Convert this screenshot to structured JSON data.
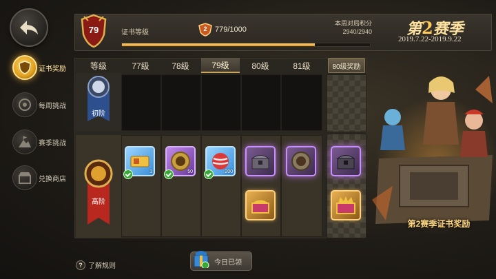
{
  "nav": {
    "back_icon": "back-arrow-icon",
    "items": [
      {
        "label": "证书奖励",
        "icon": "shield-badge-icon",
        "active": true
      },
      {
        "label": "每周挑战",
        "icon": "target-icon",
        "active": false
      },
      {
        "label": "赛季挑战",
        "icon": "mountain-flag-icon",
        "active": false
      },
      {
        "label": "兑换商店",
        "icon": "shop-icon",
        "active": false
      }
    ]
  },
  "header": {
    "level": "79",
    "cert_label": "证书等级",
    "xp_badge": "2",
    "xp_text": "779/1000",
    "xp_progress": 0.779,
    "weekly_label": "本周对局积分",
    "weekly_value": "2940/2940"
  },
  "season": {
    "prefix": "第",
    "number": "2",
    "suffix": "赛季",
    "dates": "2019.7.22-2019.9.22",
    "reward_caption": "第2赛季证书奖励"
  },
  "grid": {
    "level_header": "等级",
    "columns": [
      "77级",
      "78级",
      "79级",
      "80级",
      "81级"
    ],
    "current_column": "79级",
    "reward_header": "80级奖励",
    "tiers": [
      {
        "label": "初阶",
        "color": "#3a5a9a"
      },
      {
        "label": "高阶",
        "color": "#b8281e"
      }
    ],
    "premium_items": [
      {
        "icon": "gold-ticket-icon",
        "qty": "1",
        "claimed": true,
        "style": "blue"
      },
      {
        "icon": "lion-token-icon",
        "qty": "50",
        "claimed": true,
        "style": "purple"
      },
      {
        "icon": "red-striped-ball-icon",
        "qty": "200",
        "claimed": true,
        "style": "blue"
      },
      {
        "icon": "chest-icon",
        "qty": "",
        "claimed": false,
        "style": "purple-glow"
      },
      {
        "icon": "lion-token-icon",
        "qty": "",
        "claimed": false,
        "style": "purple-glow"
      },
      {
        "icon": "chest-icon",
        "qty": "",
        "claimed": false,
        "style": "purple-glow"
      }
    ],
    "bonus_items": [
      {
        "icon": "gold-chest-icon",
        "qty": "",
        "claimed": false
      },
      {
        "icon": "gold-crown-chest-icon",
        "qty": "",
        "claimed": false
      }
    ]
  },
  "footer": {
    "rules_label": "了解规则",
    "claimed_label": "今日已领"
  },
  "colors": {
    "accent_gold": "#e09a2a",
    "check_green": "#3aa838",
    "purple_glow": "#c890ff"
  }
}
